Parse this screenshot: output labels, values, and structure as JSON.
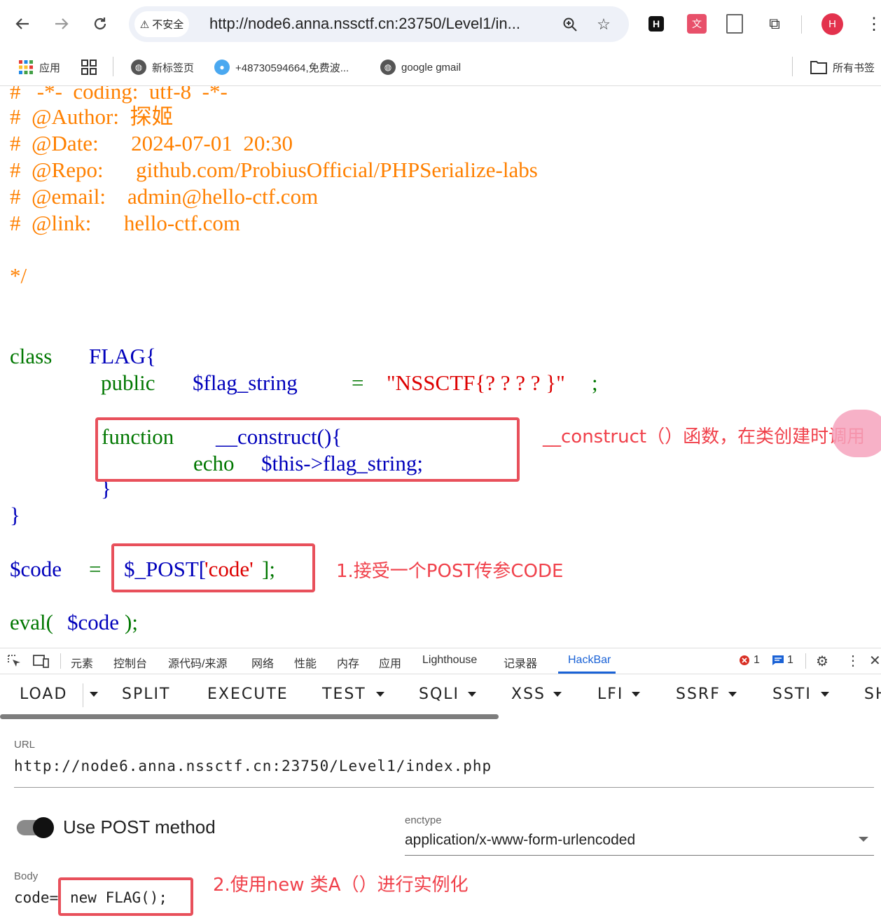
{
  "browser": {
    "security_label": "不安全",
    "url": "http://node6.anna.nssctf.cn:23750/Level1/in...",
    "avatar_letter": "H",
    "ext_icons": [
      "hackbar-icon",
      "translate-icon",
      "document-icon",
      "extensions-icon"
    ]
  },
  "bookmarks": {
    "apps_label": "应用",
    "items": [
      "新标签页",
      "+48730594664,免费波...",
      "google gmail"
    ],
    "all_bookmarks": "所有书签"
  },
  "code": {
    "comment_lines": [
      "#   -*-  coding:  utf-8  -*-",
      "#  @Author:  探姬",
      "#  @Date:      2024-07-01  20:30",
      "#  @Repo:      github.com/ProbiusOfficial/PHPSerialize-labs",
      "#  @email:    admin@hello-ctf.com",
      "#  @link:      hello-ctf.com"
    ],
    "comment_end": "*/",
    "class_kw": "class",
    "class_name": "FLAG{",
    "public_kw": "public",
    "prop_var": "$flag_string",
    "assign": "=",
    "prop_value": "\"NSSCTF{? ? ? ? }\"",
    "semicolon": ";",
    "function_kw": "function",
    "construct_name": "__construct(){",
    "echo_kw": "echo",
    "echo_expr": "$this->flag_string;",
    "inner_close": "}",
    "outer_close": "}",
    "code_var": "$code",
    "code_assign": "=",
    "post_var": "$_POST[",
    "post_key": "'code'",
    "post_end": "];",
    "eval_kw": "eval(",
    "eval_arg": "$code",
    "eval_end": ");"
  },
  "annotations": {
    "construct_note": "__construct（）函数，在类创建时调用",
    "post_note": "1.接受一个POST传参CODE",
    "body_note": "2.使用new 类A（）进行实例化"
  },
  "devtools": {
    "tabs": [
      "元素",
      "控制台",
      "源代码/来源",
      "网络",
      "性能",
      "内存",
      "应用",
      "Lighthouse",
      "记录器",
      "HackBar"
    ],
    "active_tab": "HackBar",
    "error_count": "1",
    "message_count": "1"
  },
  "hackbar": {
    "menu": [
      "LOAD",
      "SPLIT",
      "EXECUTE",
      "TEST",
      "SQLI",
      "XSS",
      "LFI",
      "SSRF",
      "SSTI",
      "SH"
    ],
    "url_label": "URL",
    "url_value": "http://node6.anna.nssctf.cn:23750/Level1/index.php",
    "post_toggle_label": "Use POST method",
    "enctype_label": "enctype",
    "enctype_value": "application/x-www-form-urlencoded",
    "body_label": "Body",
    "body_prefix": "code=",
    "body_value": "new FLAG();"
  },
  "colors": {
    "comment": "#ff8000",
    "keyword": "#007700",
    "variable": "#0000bb",
    "string": "#dd0000",
    "annotation": "#f0414b",
    "active_tab": "#1a62d6"
  }
}
